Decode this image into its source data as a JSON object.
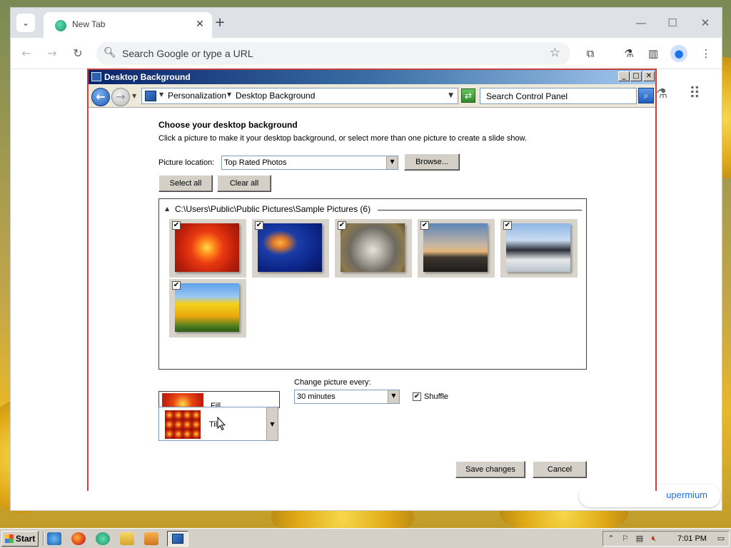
{
  "browser": {
    "tab_title": "New Tab",
    "omnibox_placeholder": "Search Google or type a URL",
    "customize_label": "upermium"
  },
  "window": {
    "title": "Desktop Background",
    "breadcrumb": [
      "Personalization",
      "Desktop Background"
    ],
    "search_placeholder": "Search Control Panel",
    "heading": "Choose your desktop background",
    "subtext": "Click a picture to make it your desktop background, or select more than one picture to create a slide show.",
    "picture_location_label": "Picture location:",
    "picture_location_value": "Top Rated Photos",
    "browse_label": "Browse...",
    "select_all_label": "Select all",
    "clear_all_label": "Clear all",
    "group_title": "C:\\Users\\Public\\Public Pictures\\Sample Pictures (6)",
    "thumbnails": [
      {
        "name": "flower",
        "checked": true
      },
      {
        "name": "jellyfish",
        "checked": true
      },
      {
        "name": "koala",
        "checked": true
      },
      {
        "name": "lighthouse",
        "checked": true
      },
      {
        "name": "penguins",
        "checked": true
      },
      {
        "name": "tulips",
        "checked": true
      }
    ],
    "position_options": [
      "Fill",
      "Tile"
    ],
    "position_selected": "Tile",
    "change_every_label": "Change picture every:",
    "change_every_value": "30 minutes",
    "shuffle_label": "Shuffle",
    "shuffle_checked": true,
    "save_label": "Save changes",
    "cancel_label": "Cancel"
  },
  "taskbar": {
    "start_label": "Start",
    "clock": "7:01 PM"
  },
  "icons": {
    "checkmark": "✔"
  }
}
